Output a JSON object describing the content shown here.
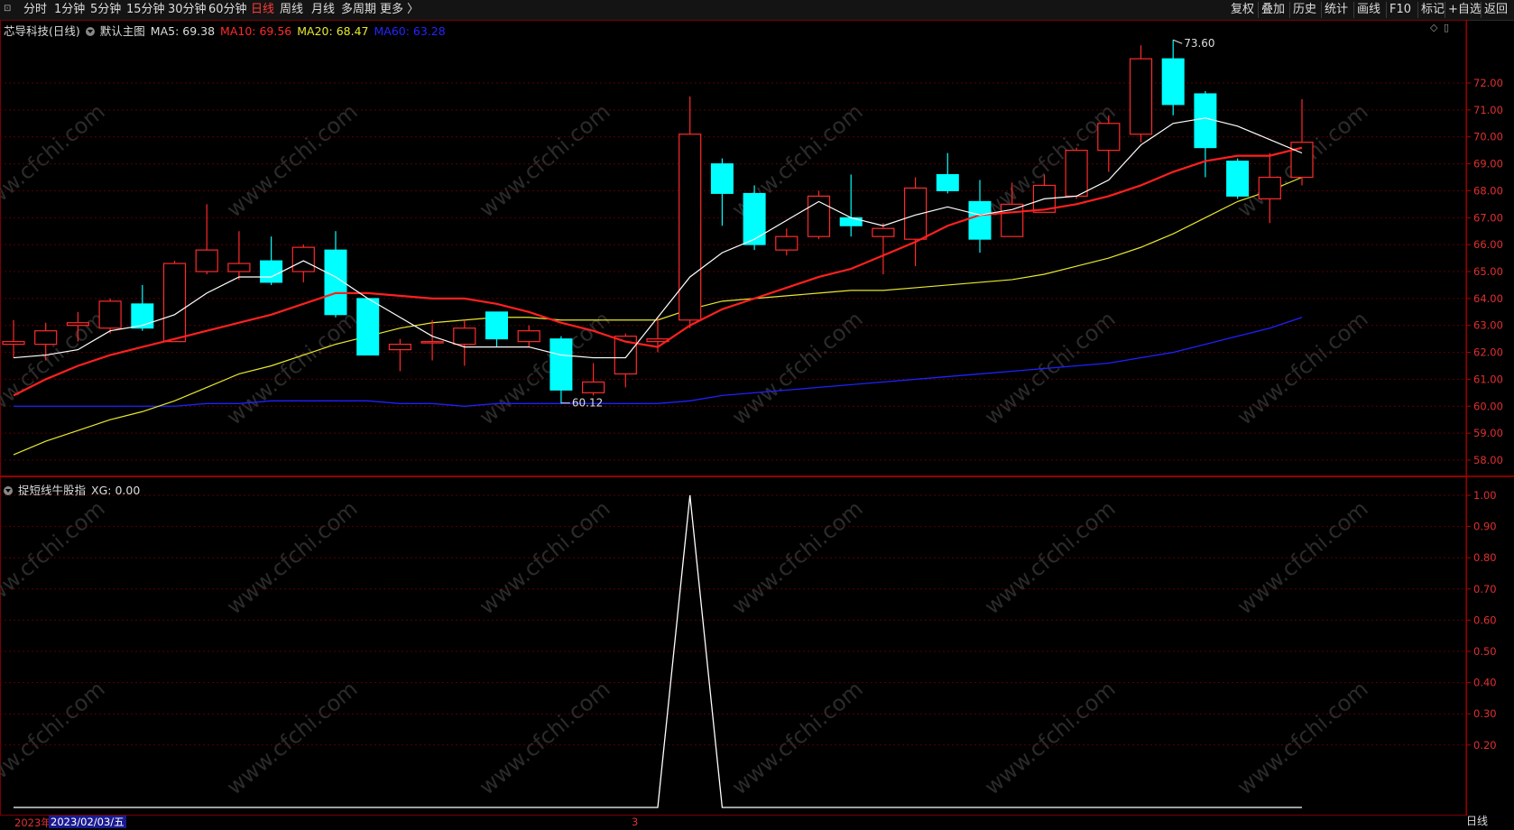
{
  "toolbar": {
    "left": [
      {
        "label": "分时",
        "active": false
      },
      {
        "label": "1分钟",
        "active": false
      },
      {
        "label": "5分钟",
        "active": false
      },
      {
        "label": "15分钟",
        "active": false
      },
      {
        "label": "30分钟",
        "active": false
      },
      {
        "label": "60分钟",
        "active": false
      },
      {
        "label": "日线",
        "active": true
      },
      {
        "label": "周线",
        "active": false
      },
      {
        "label": "月线",
        "active": false
      },
      {
        "label": "多周期",
        "active": false
      },
      {
        "label": "更多 〉",
        "active": false
      }
    ],
    "right": [
      "复权",
      "叠加",
      "历史",
      "统计",
      "画线",
      "F10",
      "标记",
      "+自选",
      "返回"
    ]
  },
  "main_header": {
    "stock": "芯导科技(日线)",
    "chart_name": "默认主图",
    "ma5": "MA5: 69.38",
    "ma10": "MA10: 69.56",
    "ma20": "MA20: 68.47",
    "ma60": "MA60: 63.28"
  },
  "sub_header": {
    "indicator": "捉短线牛股指",
    "xg": "XG: 0.00"
  },
  "colors": {
    "up": "#ff2a2a",
    "down": "#00ffff",
    "ma5": "#ffffff",
    "ma10": "#ff2020",
    "ma20": "#e8e830",
    "ma60": "#2020ff",
    "grid": "#5a0000",
    "axis": "#e03030"
  },
  "price_axis": [
    "72.00",
    "71.00",
    "70.00",
    "69.00",
    "68.00",
    "67.00",
    "66.00",
    "65.00",
    "64.00",
    "63.00",
    "62.00",
    "61.00",
    "60.00",
    "59.00",
    "58.00"
  ],
  "sub_axis": [
    "1.00",
    "0.90",
    "0.80",
    "0.70",
    "0.60",
    "0.50",
    "0.40",
    "0.30",
    "0.20"
  ],
  "annotations": {
    "high": "73.60",
    "low": "60.12"
  },
  "watermark": "www.cfchi.com",
  "bottom": {
    "year": "2023年",
    "date": "2023/02/03/五",
    "marker": "3"
  },
  "period_label": "日线",
  "chart_data": [
    {
      "type": "candlestick",
      "ylim": [
        57.5,
        74.5
      ],
      "candles": [
        {
          "o": 62.3,
          "c": 62.4,
          "h": 63.2,
          "l": 61.8
        },
        {
          "o": 62.3,
          "c": 62.8,
          "h": 63.1,
          "l": 61.7
        },
        {
          "o": 63.0,
          "c": 63.1,
          "h": 63.5,
          "l": 62.4
        },
        {
          "o": 62.9,
          "c": 63.9,
          "h": 64.0,
          "l": 62.7
        },
        {
          "o": 63.8,
          "c": 62.9,
          "h": 64.5,
          "l": 62.8
        },
        {
          "o": 62.4,
          "c": 65.3,
          "h": 65.4,
          "l": 62.4
        },
        {
          "o": 65.0,
          "c": 65.8,
          "h": 67.5,
          "l": 64.9
        },
        {
          "o": 65.0,
          "c": 65.3,
          "h": 66.5,
          "l": 64.7
        },
        {
          "o": 65.4,
          "c": 64.6,
          "h": 66.3,
          "l": 64.5
        },
        {
          "o": 65.0,
          "c": 65.9,
          "h": 66.0,
          "l": 64.6
        },
        {
          "o": 65.8,
          "c": 63.4,
          "h": 66.5,
          "l": 63.3
        },
        {
          "o": 64.0,
          "c": 61.9,
          "h": 64.0,
          "l": 61.9
        },
        {
          "o": 62.1,
          "c": 62.3,
          "h": 62.5,
          "l": 61.3
        },
        {
          "o": 62.4,
          "c": 62.4,
          "h": 63.2,
          "l": 61.7
        },
        {
          "o": 62.3,
          "c": 62.9,
          "h": 63.2,
          "l": 61.5
        },
        {
          "o": 63.5,
          "c": 62.5,
          "h": 63.5,
          "l": 62.2
        },
        {
          "o": 62.4,
          "c": 62.8,
          "h": 63.0,
          "l": 62.2
        },
        {
          "o": 62.5,
          "c": 60.6,
          "h": 62.6,
          "l": 60.1
        },
        {
          "o": 60.5,
          "c": 60.9,
          "h": 61.6,
          "l": 60.4
        },
        {
          "o": 61.2,
          "c": 62.6,
          "h": 62.7,
          "l": 60.7
        },
        {
          "o": 62.4,
          "c": 62.5,
          "h": 63.3,
          "l": 62.0
        },
        {
          "o": 63.2,
          "c": 70.1,
          "h": 71.5,
          "l": 62.9
        },
        {
          "o": 69.0,
          "c": 67.9,
          "h": 69.2,
          "l": 66.7
        },
        {
          "o": 67.9,
          "c": 66.0,
          "h": 68.2,
          "l": 65.8
        },
        {
          "o": 65.8,
          "c": 66.3,
          "h": 66.6,
          "l": 65.6
        },
        {
          "o": 66.3,
          "c": 67.8,
          "h": 68.0,
          "l": 66.2
        },
        {
          "o": 67.0,
          "c": 66.7,
          "h": 68.6,
          "l": 66.3
        },
        {
          "o": 66.3,
          "c": 66.6,
          "h": 66.8,
          "l": 64.9
        },
        {
          "o": 66.2,
          "c": 68.1,
          "h": 68.5,
          "l": 65.2
        },
        {
          "o": 68.6,
          "c": 68.0,
          "h": 69.4,
          "l": 67.9
        },
        {
          "o": 67.6,
          "c": 66.2,
          "h": 68.4,
          "l": 65.7
        },
        {
          "o": 66.3,
          "c": 67.5,
          "h": 68.3,
          "l": 66.3
        },
        {
          "o": 67.2,
          "c": 68.2,
          "h": 68.6,
          "l": 67.2
        },
        {
          "o": 67.8,
          "c": 69.5,
          "h": 69.6,
          "l": 67.7
        },
        {
          "o": 69.5,
          "c": 70.5,
          "h": 70.8,
          "l": 68.7
        },
        {
          "o": 70.1,
          "c": 72.9,
          "h": 73.4,
          "l": 69.8
        },
        {
          "o": 72.9,
          "c": 71.2,
          "h": 73.6,
          "l": 70.8
        },
        {
          "o": 71.6,
          "c": 69.6,
          "h": 71.7,
          "l": 68.5
        },
        {
          "o": 69.1,
          "c": 67.8,
          "h": 69.2,
          "l": 67.7
        },
        {
          "o": 67.7,
          "c": 68.5,
          "h": 69.4,
          "l": 66.8
        },
        {
          "o": 68.5,
          "c": 69.8,
          "h": 71.4,
          "l": 68.2
        }
      ],
      "ma5": [
        61.8,
        61.9,
        62.1,
        62.8,
        63.0,
        63.4,
        64.2,
        64.8,
        64.8,
        65.4,
        64.8,
        64.0,
        63.3,
        62.6,
        62.2,
        62.2,
        62.2,
        61.9,
        61.8,
        61.8,
        63.3,
        64.8,
        65.7,
        66.2,
        66.9,
        67.6,
        67.0,
        66.7,
        67.1,
        67.4,
        67.1,
        67.3,
        67.7,
        67.8,
        68.4,
        69.7,
        70.5,
        70.7,
        70.4,
        69.9,
        69.4
      ],
      "ma10": [
        60.4,
        61.0,
        61.5,
        61.9,
        62.2,
        62.5,
        62.8,
        63.1,
        63.4,
        63.8,
        64.2,
        64.2,
        64.1,
        64.0,
        64.0,
        63.8,
        63.5,
        63.1,
        62.8,
        62.4,
        62.2,
        63.0,
        63.6,
        64.0,
        64.4,
        64.8,
        65.1,
        65.6,
        66.1,
        66.7,
        67.1,
        67.2,
        67.3,
        67.5,
        67.8,
        68.2,
        68.7,
        69.1,
        69.3,
        69.3,
        69.6
      ],
      "ma20": [
        58.2,
        58.7,
        59.1,
        59.5,
        59.8,
        60.2,
        60.7,
        61.2,
        61.5,
        61.9,
        62.3,
        62.6,
        62.9,
        63.1,
        63.2,
        63.3,
        63.3,
        63.2,
        63.2,
        63.2,
        63.2,
        63.6,
        63.9,
        64.0,
        64.1,
        64.2,
        64.3,
        64.3,
        64.4,
        64.5,
        64.6,
        64.7,
        64.9,
        65.2,
        65.5,
        65.9,
        66.4,
        67.0,
        67.6,
        68.0,
        68.5
      ],
      "ma60": [
        60.0,
        60.0,
        60.0,
        60.0,
        60.0,
        60.0,
        60.1,
        60.1,
        60.2,
        60.2,
        60.2,
        60.2,
        60.1,
        60.1,
        60.0,
        60.1,
        60.1,
        60.1,
        60.1,
        60.1,
        60.1,
        60.2,
        60.4,
        60.5,
        60.6,
        60.7,
        60.8,
        60.9,
        61.0,
        61.1,
        61.2,
        61.3,
        61.4,
        61.5,
        61.6,
        61.8,
        62.0,
        62.3,
        62.6,
        62.9,
        63.3
      ]
    },
    {
      "type": "line",
      "name": "XG",
      "ylim": [
        0,
        1.0
      ],
      "values": [
        0,
        0,
        0,
        0,
        0,
        0,
        0,
        0,
        0,
        0,
        0,
        0,
        0,
        0,
        0,
        0,
        0,
        0,
        0,
        0,
        0,
        1,
        0,
        0,
        0,
        0,
        0,
        0,
        0,
        0,
        0,
        0,
        0,
        0,
        0,
        0,
        0,
        0,
        0,
        0,
        0
      ]
    }
  ]
}
